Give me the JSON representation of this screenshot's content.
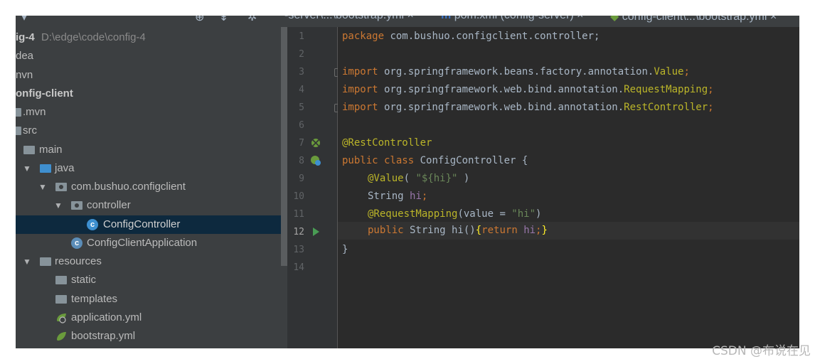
{
  "toolbar": {
    "tab1": "-server\\...\\bootstrap.yml",
    "tab2": "pom.xml (config-server)",
    "tab3": "config-client\\...\\bootstrap.yml"
  },
  "project_tree": [
    {
      "label": "ig-4",
      "sub": "D:\\edge\\code\\config-4",
      "bold": true
    },
    {
      "label": "dea"
    },
    {
      "label": "nvn"
    },
    {
      "label": "onfig-client",
      "bold": true
    },
    {
      "label": ".mvn"
    },
    {
      "label": "src"
    },
    {
      "label": "main"
    },
    {
      "label": "java"
    },
    {
      "label": "com.bushuo.configclient"
    },
    {
      "label": "controller"
    },
    {
      "label": "ConfigController",
      "selected": true
    },
    {
      "label": "ConfigClientApplication"
    },
    {
      "label": "resources"
    },
    {
      "label": "static"
    },
    {
      "label": "templates"
    },
    {
      "label": "application.yml"
    },
    {
      "label": "bootstrap.yml"
    }
  ],
  "editor": {
    "line_numbers": [
      "1",
      "2",
      "3",
      "4",
      "5",
      "6",
      "7",
      "8",
      "9",
      "10",
      "11",
      "12",
      "13",
      "14"
    ],
    "current_line": "12",
    "code": {
      "l1_kw": "package",
      "l1_rest": " com.bushuo.configclient.controller;",
      "l3_kw": "import",
      "l3_pkg": " org.springframework.beans.factory.annotation.",
      "l3_cls": "Value",
      "l3_end": ";",
      "l4_kw": "import",
      "l4_pkg": " org.springframework.web.bind.annotation.",
      "l4_cls": "RequestMapping",
      "l4_end": ";",
      "l5_kw": "import",
      "l5_pkg": " org.springframework.web.bind.annotation.",
      "l5_cls": "RestController",
      "l5_end": ";",
      "l7_an": "@RestController",
      "l8_kw": "public class",
      "l8_rest": " ConfigController {",
      "l9_an": "@Value",
      "l9_open": "( ",
      "l9_str": "\"${hi}\"",
      "l9_close": " )",
      "l10_type": "String ",
      "l10_fld": "hi",
      "l10_end": ";",
      "l11_an": "@RequestMapping",
      "l11_open": "(value = ",
      "l11_str": "\"hi\"",
      "l11_close": ")",
      "l12_kw": "public",
      "l12_rest": " String hi()",
      "l12_br1": "{",
      "l12_ret": "return",
      "l12_sp": " ",
      "l12_fld": "hi",
      "l12_semi": ";",
      "l12_br2": "}",
      "l13": "}"
    }
  },
  "watermark": "CSDN @布说在见"
}
